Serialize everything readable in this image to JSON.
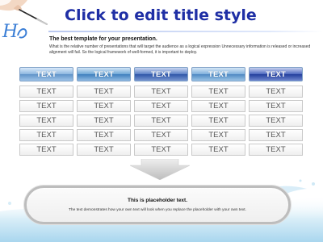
{
  "slide": {
    "title": "Click to edit title style",
    "subtitle": "The best template for your presentation.",
    "body": "What is the relative number of presentations that will target the audience as a logical expression Unnecessary information is released or increased alignment will fail. So the logical framework of well-formed, it is important to deploy.",
    "art": {
      "brush_text": "H"
    },
    "colors": {
      "title": "#1f2fa5",
      "accent": "#2e55a8"
    }
  },
  "table": {
    "headers": [
      "TEXT",
      "TEXT",
      "TEXT",
      "TEXT",
      "TEXT"
    ],
    "rows": [
      [
        "TEXT",
        "TEXT",
        "TEXT",
        "TEXT",
        "TEXT"
      ],
      [
        "TEXT",
        "TEXT",
        "TEXT",
        "TEXT",
        "TEXT"
      ],
      [
        "TEXT",
        "TEXT",
        "TEXT",
        "TEXT",
        "TEXT"
      ],
      [
        "TEXT",
        "TEXT",
        "TEXT",
        "TEXT",
        "TEXT"
      ],
      [
        "TEXT",
        "TEXT",
        "TEXT",
        "TEXT",
        "TEXT"
      ]
    ]
  },
  "placeholder": {
    "title": "This is placeholder text.",
    "text": "The text demonstrates how your own text will look when you replace the placeholder with your own text."
  }
}
